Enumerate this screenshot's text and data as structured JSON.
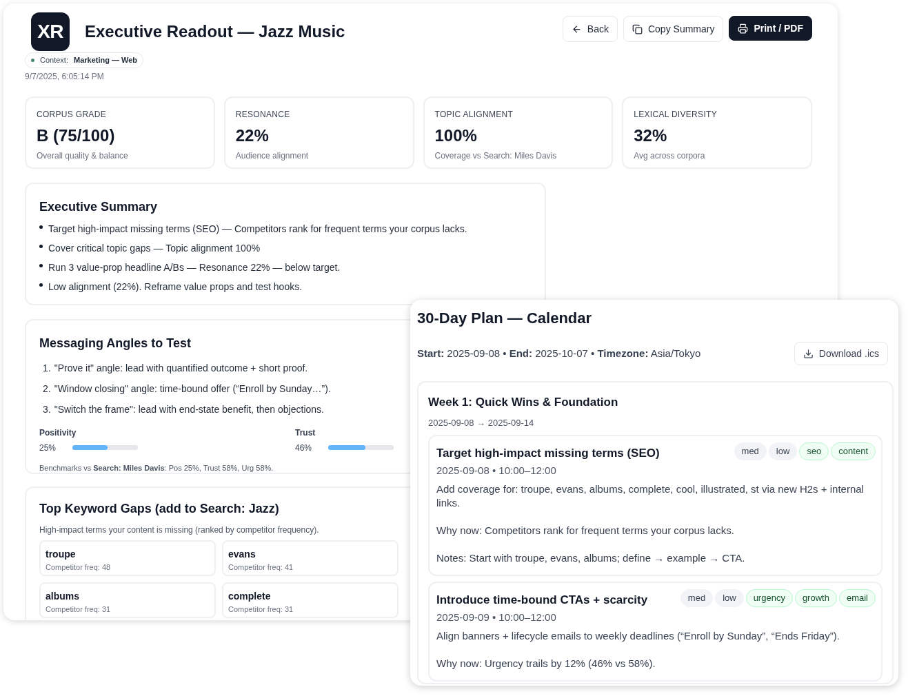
{
  "header": {
    "logo": "XR",
    "title": "Executive Readout — Jazz Music",
    "context_label": "Context:",
    "context_value": "Marketing — Web",
    "timestamp": "9/7/2025, 6:05:14 PM"
  },
  "buttons": [
    {
      "label": "Back",
      "primary": false
    },
    {
      "label": "Copy Summary",
      "primary": false
    },
    {
      "label": "Print / PDF",
      "primary": true
    }
  ],
  "kpis": [
    {
      "label": "CORPUS GRADE",
      "value": "B (75/100)",
      "note": "Overall quality & balance"
    },
    {
      "label": "RESONANCE",
      "value": "22%",
      "note": "Audience alignment"
    },
    {
      "label": "TOPIC ALIGNMENT",
      "value": "100%",
      "note": "Coverage vs Search: Miles Davis"
    },
    {
      "label": "LEXICAL DIVERSITY",
      "value": "32%",
      "note": "Avg across corpora"
    }
  ],
  "summary": {
    "title": "Executive Summary",
    "items": [
      "Target high-impact missing terms (SEO) — Competitors rank for frequent terms your corpus lacks.",
      "Cover critical topic gaps — Topic alignment 100%",
      "Run 3 value-prop headline A/Bs — Resonance 22% — below target.",
      "Low alignment (22%). Reframe value props and test hooks."
    ]
  },
  "angles": {
    "title": "Messaging Angles to Test",
    "items": [
      {
        "number": "1.",
        "text": "\"Prove it\" angle: lead with quantified outcome + short proof."
      },
      {
        "number": "2.",
        "text": "\"Window closing\" angle: time-bound offer (“Enroll by Sunday…”)."
      },
      {
        "number": "3.",
        "text": "\"Switch the frame\": lead with end-state benefit, then objections."
      }
    ],
    "meters": [
      {
        "name": "Positivity",
        "reading": "25%",
        "level": 0.54
      },
      {
        "name": "Trust",
        "reading": "46%",
        "level": 0.57
      }
    ],
    "benchmark": "Benchmarks vs **Search: Miles Davis**: Pos 25%, Trust 58%, Urg 58%."
  },
  "keyword_gaps": {
    "title": "Top Keyword Gaps (add to Search: Jazz)",
    "subtitle": "High-impact terms your content is missing (ranked by competitor frequency).",
    "terms": [
      {
        "term": "troupe",
        "freq": "Competitor freq: 48"
      },
      {
        "term": "evans",
        "freq": "Competitor freq: 41"
      },
      {
        "term": "albums",
        "freq": "Competitor freq: 31"
      },
      {
        "term": "complete",
        "freq": "Competitor freq: 31"
      }
    ]
  },
  "plan": {
    "title": "30-Day Plan — Calendar",
    "meta": "**Start:** 2025-09-08 • **End:** 2025-10-07 • **Timezone:** Asia/Tokyo",
    "download": "Download .ics",
    "week": {
      "title": "Week 1: Quick Wins & Foundation",
      "range": "2025-09-08 → 2025-09-14",
      "tasks": [
        {
          "title": "Target high-impact missing terms (SEO)",
          "when": "2025-09-08 • 10:00–12:00",
          "tags": [
            {
              "label": "med",
              "kind": "meta"
            },
            {
              "label": "low",
              "kind": "meta"
            },
            {
              "label": "seo",
              "kind": "topic"
            },
            {
              "label": "content",
              "kind": "topic"
            }
          ],
          "paragraphs": [
            "Add coverage for: troupe, evans, albums, complete, cool, illustrated, st via new H2s + internal links.",
            "Why now: Competitors rank for frequent terms your corpus lacks.",
            "Notes: Start with troupe, evans, albums; define → example → CTA."
          ]
        },
        {
          "title": "Introduce time-bound CTAs + scarcity",
          "when": "2025-09-09 • 10:00–12:00",
          "tags": [
            {
              "label": "med",
              "kind": "meta"
            },
            {
              "label": "low",
              "kind": "meta"
            },
            {
              "label": "urgency",
              "kind": "topic"
            },
            {
              "label": "growth",
              "kind": "topic"
            },
            {
              "label": "email",
              "kind": "topic"
            }
          ],
          "paragraphs": [
            "Align banners + lifecycle emails to weekly deadlines (“Enroll by Sunday”, “Ends Friday”).",
            "Why now: Urgency trails by 12% (46% vs 58%)."
          ]
        }
      ]
    }
  }
}
